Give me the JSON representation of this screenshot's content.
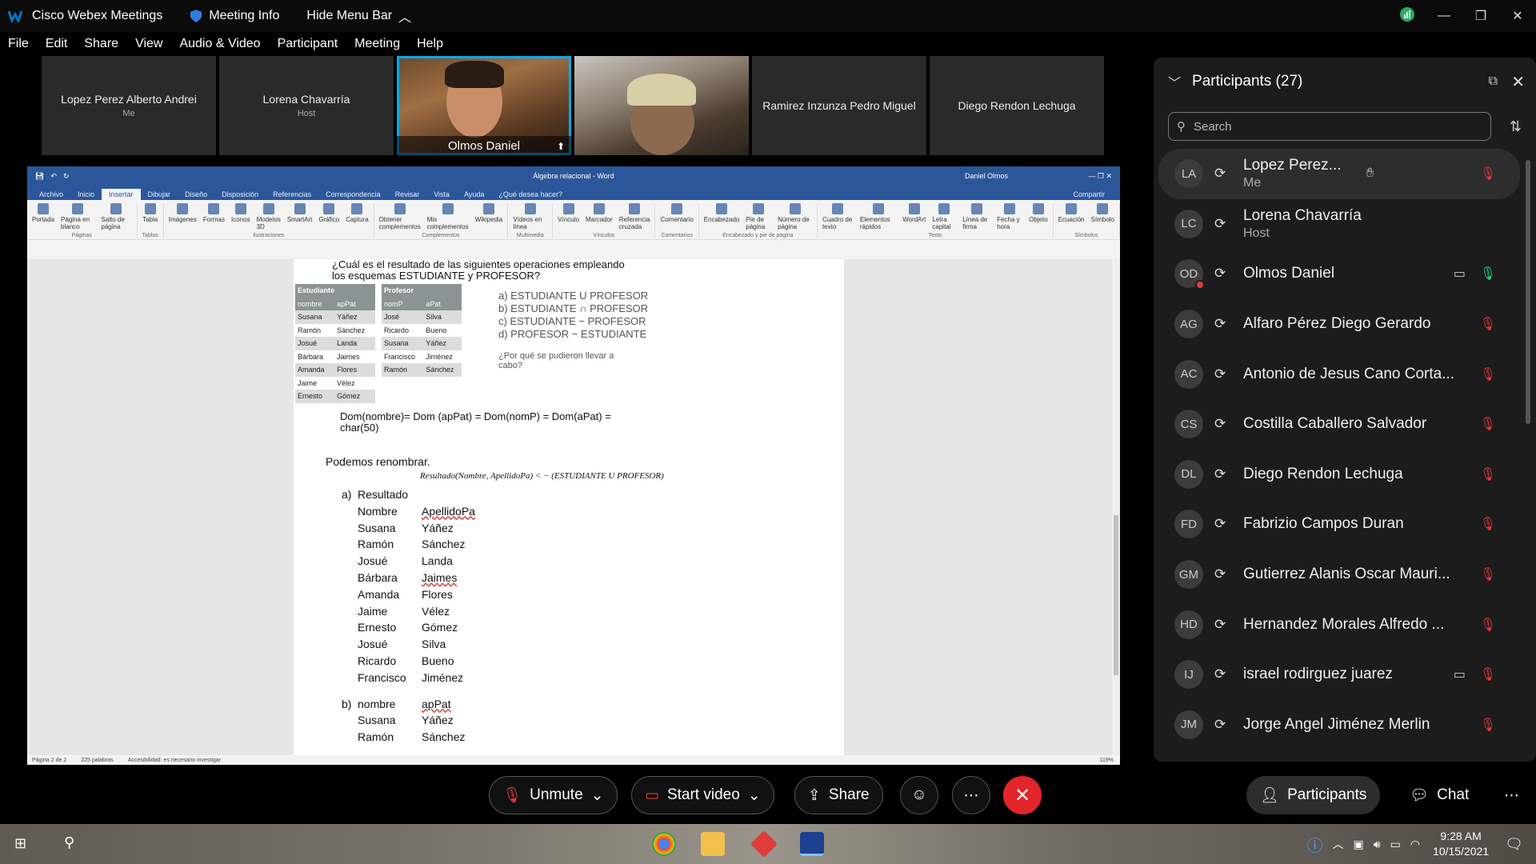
{
  "titlebar": {
    "app": "Cisco Webex Meetings",
    "info": "Meeting Info",
    "hide": "Hide Menu Bar"
  },
  "menu": [
    "File",
    "Edit",
    "Share",
    "View",
    "Audio & Video",
    "Participant",
    "Meeting",
    "Help"
  ],
  "thumbs": [
    {
      "name": "Lopez Perez Alberto Andrei",
      "role": "Me"
    },
    {
      "name": "Lorena Chavarría",
      "role": "Host"
    },
    {
      "name": "Olmos Daniel",
      "role": ""
    },
    {
      "name": "",
      "role": ""
    },
    {
      "name": "Ramirez Inzunza Pedro Miguel",
      "role": ""
    },
    {
      "name": "Diego Rendon Lechuga",
      "role": ""
    }
  ],
  "word": {
    "title": "Álgebra relacional - Word",
    "user": "Daniel Olmos",
    "share": "Compartir",
    "tabs": [
      "Archivo",
      "Inicio",
      "Insertar",
      "Dibujar",
      "Diseño",
      "Disposición",
      "Referencias",
      "Correspondencia",
      "Revisar",
      "Vista",
      "Ayuda",
      "¿Qué desea hacer?"
    ],
    "ribbon": [
      {
        "items": [
          "Portada",
          "Página en blanco",
          "Salto de página"
        ],
        "group": "Páginas"
      },
      {
        "items": [
          "Tabla"
        ],
        "group": "Tablas"
      },
      {
        "items": [
          "Imágenes",
          "Formas",
          "Iconos",
          "Modelos 3D",
          "SmartArt",
          "Gráfico",
          "Captura"
        ],
        "group": "Ilustraciones"
      },
      {
        "items": [
          "Obtener complementos",
          "Mis complementos",
          "Wikipedia"
        ],
        "group": "Complementos"
      },
      {
        "items": [
          "Vídeos en línea"
        ],
        "group": "Multimedia"
      },
      {
        "items": [
          "Vínculo",
          "Marcador",
          "Referencia cruzada"
        ],
        "group": "Vínculos"
      },
      {
        "items": [
          "Comentario"
        ],
        "group": "Comentarios"
      },
      {
        "items": [
          "Encabezado",
          "Pie de página",
          "Número de página"
        ],
        "group": "Encabezado y pie de página"
      },
      {
        "items": [
          "Cuadro de texto",
          "Elementos rápidos",
          "WordArt",
          "Letra capital",
          "Línea de firma",
          "Fecha y hora",
          "Objeto"
        ],
        "group": "Texto"
      },
      {
        "items": [
          "Ecuación",
          "Símbolo"
        ],
        "group": "Símbolos"
      }
    ],
    "question": "¿Cuál es el resultado de las siguientes operaciones empleando los esquemas ESTUDIANTE y PROFESOR?",
    "est_title": "Estudiante",
    "est_headers": [
      "nombre",
      "apPat"
    ],
    "est_rows": [
      [
        "Susana",
        "Yáñez"
      ],
      [
        "Ramón",
        "Sánchez"
      ],
      [
        "Josué",
        "Landa"
      ],
      [
        "Bárbara",
        "Jaimes"
      ],
      [
        "Amanda",
        "Flores"
      ],
      [
        "Jaime",
        "Vélez"
      ],
      [
        "Ernesto",
        "Gómez"
      ]
    ],
    "prof_title": "Profesor",
    "prof_headers": [
      "nomP",
      "aPat"
    ],
    "prof_rows": [
      [
        "José",
        "Silva"
      ],
      [
        "Ricardo",
        "Bueno"
      ],
      [
        "Susana",
        "Yáñez"
      ],
      [
        "Francisco",
        "Jiménez"
      ],
      [
        "Ramón",
        "Sánchez"
      ]
    ],
    "ops": [
      "a) ESTUDIANTE U PROFESOR",
      "b) ESTUDIANTE ∩ PROFESOR",
      "c) ESTUDIANTE − PROFESOR",
      "d) PROFESOR − ESTUDIANTE"
    ],
    "why": "¿Por qué se pudieron llevar a cabo?",
    "dom": "Dom(nombre)= Dom (apPat) = Dom(nomP) = Dom(aPat) = char(50)",
    "rename": "Podemos renombrar.",
    "formula": "Resultado(Nombre, ApellidoPa) < − (ESTUDIANTE U PROFESOR)",
    "a_label": "a)",
    "a_title": "Resultado",
    "a_header": [
      "Nombre",
      "ApellidoPa"
    ],
    "a_rows": [
      [
        "Susana",
        "Yáñez"
      ],
      [
        "Ramón",
        "Sánchez"
      ],
      [
        "Josué",
        "Landa"
      ],
      [
        "Bárbara",
        "Jaimes"
      ],
      [
        "Amanda",
        "Flores"
      ],
      [
        "Jaime",
        "Vélez"
      ],
      [
        "Ernesto",
        "Gómez"
      ],
      [
        "Josué",
        "Silva"
      ],
      [
        "Ricardo",
        "Bueno"
      ],
      [
        "Francisco",
        "Jiménez"
      ]
    ],
    "b_label": "b)",
    "b_header": [
      "nombre",
      "apPat"
    ],
    "b_rows": [
      [
        "Susana",
        "Yáñez"
      ],
      [
        "Ramón",
        "Sánchez"
      ]
    ],
    "status": [
      "Página 2 de 2",
      "225 palabras",
      "Accesibilidad: es necesario investigar",
      "119%"
    ]
  },
  "panel": {
    "title": "Participants (27)",
    "search": "Search",
    "people": [
      {
        "init": "LA",
        "name": "Lopez Perez...",
        "sub": "Me",
        "mic": "muted",
        "cam": false,
        "hand": true
      },
      {
        "init": "LC",
        "name": "Lorena Chavarría",
        "sub": "Host",
        "mic": "",
        "cam": false
      },
      {
        "init": "OD",
        "name": "Olmos Daniel",
        "sub": "",
        "mic": "on",
        "cam": true,
        "dot": true
      },
      {
        "init": "AG",
        "name": "Alfaro Pérez Diego Gerardo",
        "sub": "",
        "mic": "muted"
      },
      {
        "init": "AC",
        "name": "Antonio de Jesus Cano Corta...",
        "sub": "",
        "mic": "muted"
      },
      {
        "init": "CS",
        "name": "Costilla Caballero Salvador",
        "sub": "",
        "mic": "muted"
      },
      {
        "init": "DL",
        "name": "Diego Rendon Lechuga",
        "sub": "",
        "mic": "muted"
      },
      {
        "init": "FD",
        "name": "Fabrizio Campos Duran",
        "sub": "",
        "mic": "muted"
      },
      {
        "init": "GM",
        "name": "Gutierrez Alanis Oscar Mauri...",
        "sub": "",
        "mic": "muted"
      },
      {
        "init": "HD",
        "name": "Hernandez Morales Alfredo ...",
        "sub": "",
        "mic": "muted"
      },
      {
        "init": "IJ",
        "name": "israel rodirguez juarez",
        "sub": "",
        "mic": "muted",
        "cam": true
      },
      {
        "init": "JM",
        "name": "Jorge Angel Jiménez Merlin",
        "sub": "",
        "mic": "muted"
      }
    ]
  },
  "controls": {
    "unmute": "Unmute",
    "video": "Start video",
    "share": "Share",
    "participants": "Participants",
    "chat": "Chat"
  },
  "taskbar": {
    "time": "9:28 AM",
    "date": "10/15/2021"
  }
}
